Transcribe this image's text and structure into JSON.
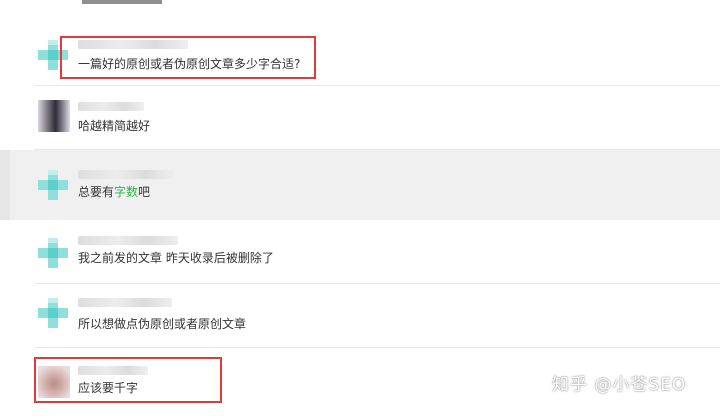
{
  "chat": {
    "messages": [
      {
        "text": "一篇好的原创或者伪原创文章多少字合适?"
      },
      {
        "text": "哈越精简越好"
      },
      {
        "text_before": "总要有",
        "text_highlight": "字数",
        "text_after": "吧"
      },
      {
        "text": "我之前发的文章  昨天收录后被删除了"
      },
      {
        "text": "所以想做点伪原创或者原创文章"
      },
      {
        "text": "应该要千字"
      }
    ]
  },
  "colors": {
    "highlight_word": "#2db34a",
    "annotation_box": "#e03b3b",
    "avatar_plus": "#8fe0dc"
  },
  "watermark": {
    "text": "知乎 @小苍SEO"
  }
}
